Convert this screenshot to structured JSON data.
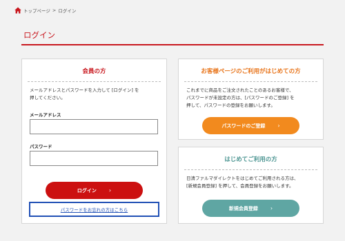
{
  "breadcrumb": {
    "home_icon": "home-icon",
    "home_label": "トップページ",
    "separator": ">",
    "current": "ログイン"
  },
  "page": {
    "title": "ログイン",
    "accent_color": "#c8161d"
  },
  "login_panel": {
    "heading": "会員の方",
    "description_line1": "メールアドレスとパスワードを入力して [ログイン] を",
    "description_line2": "押してください。",
    "email_label": "メールアドレス",
    "email_value": "",
    "password_label": "パスワード",
    "password_value": "",
    "login_button": "ログイン",
    "chevron": "›",
    "forgot_link": "パスワードをお忘れの方はこちら"
  },
  "first_mypage_panel": {
    "heading": "お客様ページのご利用がはじめての方",
    "description_line1": "これまでに商品をご注文されたことのあるお客様で、",
    "description_line2": "パスワードが未設定の方は、[パスワードのご登録] を",
    "description_line3": "押して、パスワードの登録をお願いします。",
    "button": "パスワードのご登録",
    "chevron": "›",
    "button_color": "#f28a1e"
  },
  "new_user_panel": {
    "heading": "はじめてご利用の方",
    "description_line1": "日清ファルマダイレクトをはじめてご利用される方は、",
    "description_line2": "[新規会員登録] を押して、会員登録をお願いします。",
    "button": "新規会員登録",
    "chevron": "›",
    "button_color": "#5fa6a3"
  }
}
